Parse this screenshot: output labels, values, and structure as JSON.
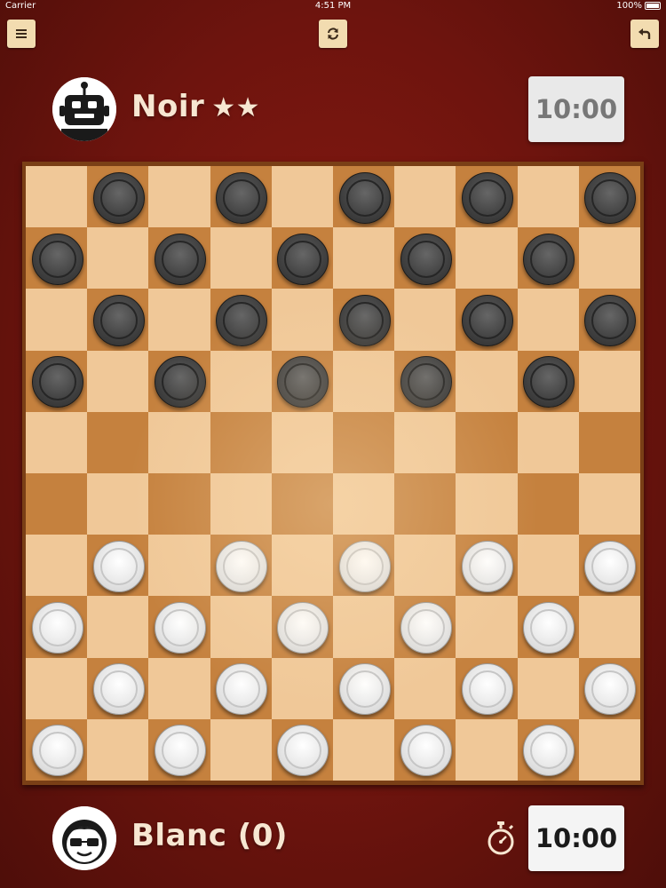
{
  "status_bar": {
    "carrier": "Carrier",
    "time": "4:51 PM",
    "battery": "100%"
  },
  "toolbar": {
    "menu_icon": "menu-icon",
    "refresh_icon": "refresh-icon",
    "undo_icon": "undo-icon"
  },
  "top_player": {
    "name": "Noir",
    "stars": "★★",
    "avatar": "robot-icon",
    "clock": "10:00"
  },
  "bottom_player": {
    "name": "Blanc (0)",
    "avatar": "glasses-boy-icon",
    "clock": "10:00",
    "timer_icon": "stopwatch-icon"
  },
  "colors": {
    "background": "#6e140e",
    "light_square": "#f0c898",
    "dark_square": "#c5813e",
    "frame": "#7a3f16"
  },
  "board": {
    "size": 10,
    "rows": [
      ".b.b.b.b.b",
      "b.b.b.b.b.",
      ".b.b.b.b.b",
      "b.b.b.b.b.",
      "..........",
      "..........",
      ".w.w.w.w.w",
      "w.w.w.w.w.",
      ".w.w.w.w.w",
      "w.w.w.w.w."
    ]
  }
}
